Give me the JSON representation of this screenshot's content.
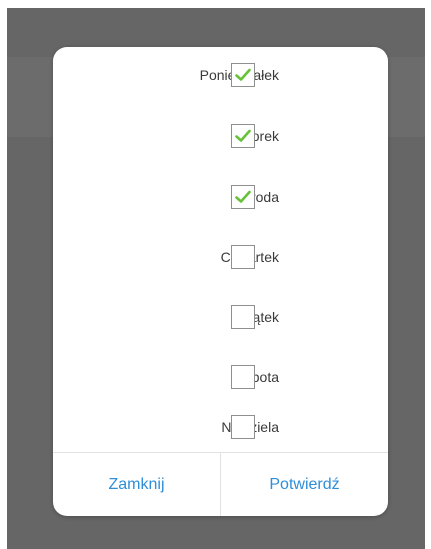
{
  "dialog": {
    "days": [
      {
        "label": "Poniedziałek",
        "checked": true
      },
      {
        "label": "Wtorek",
        "checked": true
      },
      {
        "label": "Środa",
        "checked": true
      },
      {
        "label": "Czwartek",
        "checked": false
      },
      {
        "label": "Piątek",
        "checked": false
      },
      {
        "label": "Sobota",
        "checked": false
      },
      {
        "label": "Niedziela",
        "checked": false
      }
    ],
    "close_label": "Zamknij",
    "confirm_label": "Potwierdź"
  },
  "colors": {
    "check": "#67c23a",
    "button_text": "#2e8ed8",
    "backdrop": "#666666"
  },
  "icons": {
    "check": "check-icon"
  }
}
